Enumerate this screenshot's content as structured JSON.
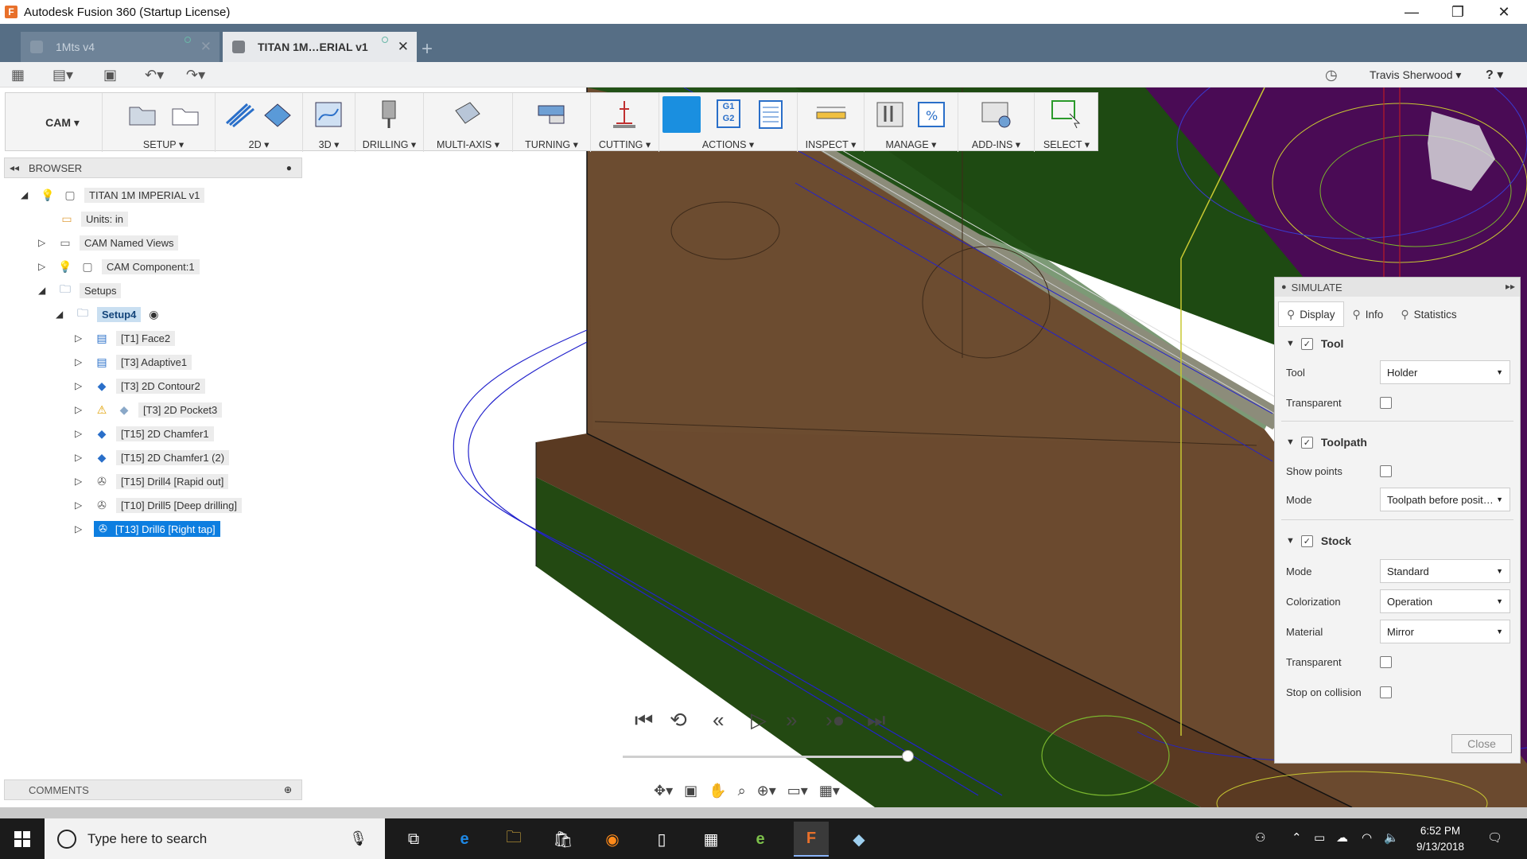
{
  "window": {
    "title": "Autodesk Fusion 360 (Startup License)",
    "app_icon": "F",
    "controls": [
      "—",
      "❐",
      "✕"
    ]
  },
  "tabs": [
    {
      "label": "1Mts v4"
    },
    {
      "label": "TITAN 1M…ERIAL v1"
    }
  ],
  "new_tab": "+",
  "quick": {
    "user": "Travis Sherwood ▾",
    "help": "? ▾"
  },
  "ribbon": {
    "workspace": "CAM ▾",
    "groups": [
      "SETUP ▾",
      "2D ▾",
      "3D ▾",
      "DRILLING ▾",
      "MULTI-AXIS ▾",
      "TURNING ▾",
      "CUTTING ▾",
      "ACTIONS ▾",
      "INSPECT ▾",
      "MANAGE ▾",
      "ADD-INS ▾",
      "SELECT ▾"
    ],
    "g1g2_text": "G1\nG2"
  },
  "browser": {
    "header": "BROWSER",
    "items": [
      {
        "label": "TITAN 1M IMPERIAL v1"
      },
      {
        "label": "Units: in"
      },
      {
        "label": "CAM Named Views"
      },
      {
        "label": "CAM Component:1"
      },
      {
        "label": "Setups"
      },
      {
        "label": "Setup4"
      },
      {
        "label": "[T1] Face2"
      },
      {
        "label": "[T3] Adaptive1"
      },
      {
        "label": "[T3] 2D Contour2"
      },
      {
        "label": "[T3] 2D Pocket3"
      },
      {
        "label": "[T15] 2D Chamfer1"
      },
      {
        "label": "[T15] 2D Chamfer1 (2)"
      },
      {
        "label": "[T15] Drill4 [Rapid out]"
      },
      {
        "label": "[T10] Drill5 [Deep drilling]"
      },
      {
        "label": "[T13] Drill6 [Right tap]"
      }
    ]
  },
  "comments": {
    "label": "COMMENTS"
  },
  "simulate": {
    "title": "SIMULATE",
    "tabs": [
      "Display",
      "Info",
      "Statistics"
    ],
    "tool_section": {
      "title": "Tool",
      "checked": true
    },
    "tool_label": "Tool",
    "tool_value": "Holder",
    "transparent_label": "Transparent",
    "toolpath_section": {
      "title": "Toolpath",
      "checked": true
    },
    "show_points_label": "Show points",
    "mode_label": "Mode",
    "toolpath_mode_value": "Toolpath before posit…",
    "stock_section": {
      "title": "Stock",
      "checked": true
    },
    "stock_mode_value": "Standard",
    "colorization_label": "Colorization",
    "colorization_value": "Operation",
    "material_label": "Material",
    "material_value": "Mirror",
    "stock_transparent_label": "Transparent",
    "stop_on_collision_label": "Stop on collision",
    "close_label": "Close"
  },
  "taskbar": {
    "search_placeholder": "Type here to search",
    "time": "6:52 PM",
    "date": "9/13/2018"
  },
  "colors": {
    "tabbar": "#566e85",
    "stock_brown": "#6b4a2f",
    "green_face": "#1e4a12",
    "purple_bg": "#4a0b55",
    "selection_blue": "#0d7ee0"
  }
}
